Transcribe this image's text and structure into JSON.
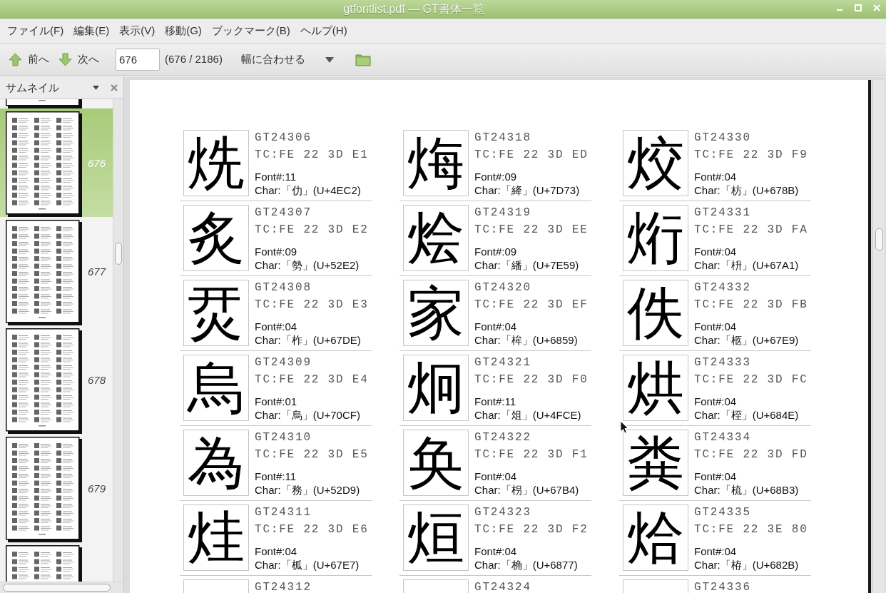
{
  "window": {
    "title": "gtfontlist.pdf — GT書体一覧"
  },
  "menu": [
    {
      "label": "ファイル(F)"
    },
    {
      "label": "編集(E)"
    },
    {
      "label": "表示(V)"
    },
    {
      "label": "移動(G)"
    },
    {
      "label": "ブックマーク(B)"
    },
    {
      "label": "ヘルプ(H)"
    }
  ],
  "toolbar": {
    "prev_label": "前へ",
    "next_label": "次へ",
    "page_field": {
      "value": "676"
    },
    "page_total": "(676 / 2186)",
    "zoom_label": "幅に合わせる"
  },
  "sidebar": {
    "title": "サムネイル",
    "thumbnails": [
      {
        "selected": false
      },
      {
        "page": "676",
        "selected": true
      },
      {
        "page": "677",
        "selected": false
      },
      {
        "page": "678",
        "selected": false
      },
      {
        "page": "679",
        "selected": false
      },
      {
        "selected": false
      }
    ]
  },
  "document": {
    "columns": [
      {
        "entries": [
          {
            "glyph": "烍",
            "code": "GT24306",
            "tc": "TC:FE 22 3D E1",
            "font": "Font#:11",
            "char": "Char:「仂」(U+4EC2)"
          },
          {
            "glyph": "炙",
            "code": "GT24307",
            "tc": "TC:FE 22 3D E2",
            "font": "Font#:09",
            "char": "Char:「勢」(U+52E2)"
          },
          {
            "glyph": "烎",
            "code": "GT24308",
            "tc": "TC:FE 22 3D E3",
            "font": "Font#:04",
            "char": "Char:「柞」(U+67DE)"
          },
          {
            "glyph": "烏",
            "code": "GT24309",
            "tc": "TC:FE 22 3D E4",
            "font": "Font#:01",
            "char": "Char:「烏」(U+70CF)"
          },
          {
            "glyph": "為",
            "code": "GT24310",
            "tc": "TC:FE 22 3D E5",
            "font": "Font#:11",
            "char": "Char:「務」(U+52D9)"
          },
          {
            "glyph": "烓",
            "code": "GT24311",
            "tc": "TC:FE 22 3D E6",
            "font": "Font#:04",
            "char": "Char:「柧」(U+67E7)"
          },
          {
            "code": "GT24312"
          }
        ]
      },
      {
        "entries": [
          {
            "glyph": "烸",
            "code": "GT24318",
            "tc": "TC:FE 22 3D ED",
            "font": "Font#:09",
            "char": "Char:「絳」(U+7D73)"
          },
          {
            "glyph": "烩",
            "code": "GT24319",
            "tc": "TC:FE 22 3D EE",
            "font": "Font#:09",
            "char": "Char:「繙」(U+7E59)"
          },
          {
            "glyph": "家",
            "code": "GT24320",
            "tc": "TC:FE 22 3D EF",
            "font": "Font#:04",
            "char": "Char:「桙」(U+6859)"
          },
          {
            "glyph": "炯",
            "code": "GT24321",
            "tc": "TC:FE 22 3D F0",
            "font": "Font#:11",
            "char": "Char:「俎」(U+4FCE)"
          },
          {
            "glyph": "奂",
            "code": "GT24322",
            "tc": "TC:FE 22 3D F1",
            "font": "Font#:04",
            "char": "Char:「枴」(U+67B4)"
          },
          {
            "glyph": "烜",
            "code": "GT24323",
            "tc": "TC:FE 22 3D F2",
            "font": "Font#:04",
            "char": "Char:「桷」(U+6877)"
          },
          {
            "code": "GT24324"
          }
        ]
      },
      {
        "entries": [
          {
            "glyph": "烄",
            "code": "GT24330",
            "tc": "TC:FE 22 3D F9",
            "font": "Font#:04",
            "char": "Char:「枋」(U+678B)"
          },
          {
            "glyph": "烆",
            "code": "GT24331",
            "tc": "TC:FE 22 3D FA",
            "font": "Font#:04",
            "char": "Char:「枡」(U+67A1)"
          },
          {
            "glyph": "佚",
            "code": "GT24332",
            "tc": "TC:FE 22 3D FB",
            "font": "Font#:04",
            "char": "Char:「柩」(U+67E9)"
          },
          {
            "glyph": "烘",
            "code": "GT24333",
            "tc": "TC:FE 22 3D FC",
            "font": "Font#:04",
            "char": "Char:「桎」(U+684E)"
          },
          {
            "glyph": "粪",
            "code": "GT24334",
            "tc": "TC:FE 22 3D FD",
            "font": "Font#:04",
            "char": "Char:「梳」(U+68B3)"
          },
          {
            "glyph": "烚",
            "code": "GT24335",
            "tc": "TC:FE 22 3E 80",
            "font": "Font#:04",
            "char": "Char:「栫」(U+682B)"
          },
          {
            "code": "GT24336"
          }
        ]
      }
    ]
  }
}
